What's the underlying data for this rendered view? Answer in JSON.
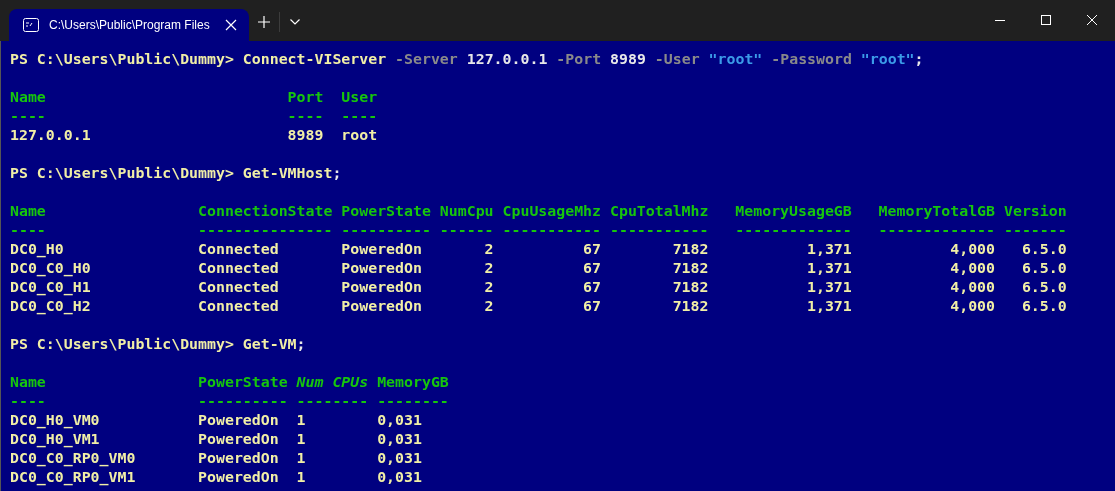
{
  "window": {
    "tabs": [
      {
        "title": "C:\\Users\\Public\\Program Files",
        "selected": true
      }
    ]
  },
  "blocks": [
    {
      "kind": "command",
      "tokens": [
        {
          "kind": "prompt",
          "text": "PS C:\\Users\\Public\\Dummy> "
        },
        {
          "kind": "command",
          "text": "Connect-VIServer"
        },
        {
          "kind": "parameter",
          "text": " -Server"
        },
        {
          "kind": "value",
          "text": " 127.0.0.1"
        },
        {
          "kind": "parameter",
          "text": " -Port"
        },
        {
          "kind": "value",
          "text": " 8989"
        },
        {
          "kind": "parameter",
          "text": " -User"
        },
        {
          "kind": "string",
          "text": " \"root\""
        },
        {
          "kind": "parameter",
          "text": " -Password"
        },
        {
          "kind": "string",
          "text": " \"root\""
        },
        {
          "kind": "value",
          "text": ";"
        }
      ]
    },
    {
      "kind": "table",
      "columns": [
        {
          "header": "Name",
          "underline": "----",
          "italic": false
        },
        {
          "header": "Port",
          "underline": "----",
          "italic": false
        },
        {
          "header": "User",
          "underline": "----",
          "italic": false
        }
      ],
      "rows": [
        [
          "127.0.0.1",
          "8989",
          "root"
        ]
      ]
    },
    {
      "kind": "command",
      "tokens": [
        {
          "kind": "prompt",
          "text": "PS C:\\Users\\Public\\Dummy> "
        },
        {
          "kind": "command",
          "text": "Get-VMHost"
        },
        {
          "kind": "value",
          "text": ";"
        }
      ]
    },
    {
      "kind": "table",
      "columns": [
        {
          "header": "Name",
          "underline": "----",
          "italic": false
        },
        {
          "header": "ConnectionState",
          "underline": "---------------",
          "italic": false
        },
        {
          "header": "PowerState",
          "underline": "----------",
          "italic": false
        },
        {
          "header": "NumCpu",
          "underline": "------",
          "italic": false
        },
        {
          "header": "CpuUsageMhz",
          "underline": "-----------",
          "italic": false
        },
        {
          "header": "CpuTotalMhz",
          "underline": "-----------",
          "italic": false
        },
        {
          "header": "MemoryUsageGB",
          "underline": "-------------",
          "italic": false
        },
        {
          "header": "MemoryTotalGB",
          "underline": "-------------",
          "italic": false
        },
        {
          "header": "Version",
          "underline": "-------",
          "italic": false
        }
      ],
      "rows": [
        [
          "DC0_H0",
          "Connected",
          "PoweredOn",
          "2",
          "67",
          "7182",
          "1,371",
          "4,000",
          "6.5.0"
        ],
        [
          "DC0_C0_H0",
          "Connected",
          "PoweredOn",
          "2",
          "67",
          "7182",
          "1,371",
          "4,000",
          "6.5.0"
        ],
        [
          "DC0_C0_H1",
          "Connected",
          "PoweredOn",
          "2",
          "67",
          "7182",
          "1,371",
          "4,000",
          "6.5.0"
        ],
        [
          "DC0_C0_H2",
          "Connected",
          "PoweredOn",
          "2",
          "67",
          "7182",
          "1,371",
          "4,000",
          "6.5.0"
        ]
      ]
    },
    {
      "kind": "command",
      "tokens": [
        {
          "kind": "prompt",
          "text": "PS C:\\Users\\Public\\Dummy> "
        },
        {
          "kind": "command",
          "text": "Get-VM"
        },
        {
          "kind": "value",
          "text": ";"
        }
      ]
    },
    {
      "kind": "table",
      "columns": [
        {
          "header": "Name",
          "underline": "----",
          "italic": false
        },
        {
          "header": "PowerState",
          "underline": "----------",
          "italic": false
        },
        {
          "header": "Num CPUs",
          "underline": "--------",
          "italic": true
        },
        {
          "header": "MemoryGB",
          "underline": "--------",
          "italic": false
        }
      ],
      "rows": [
        [
          "DC0_H0_VM0",
          "PoweredOn",
          "1",
          "0,031"
        ],
        [
          "DC0_H0_VM1",
          "PoweredOn",
          "1",
          "0,031"
        ],
        [
          "DC0_C0_RP0_VM0",
          "PoweredOn",
          "1",
          "0,031"
        ],
        [
          "DC0_C0_RP0_VM1",
          "PoweredOn",
          "1",
          "0,031"
        ]
      ]
    }
  ]
}
